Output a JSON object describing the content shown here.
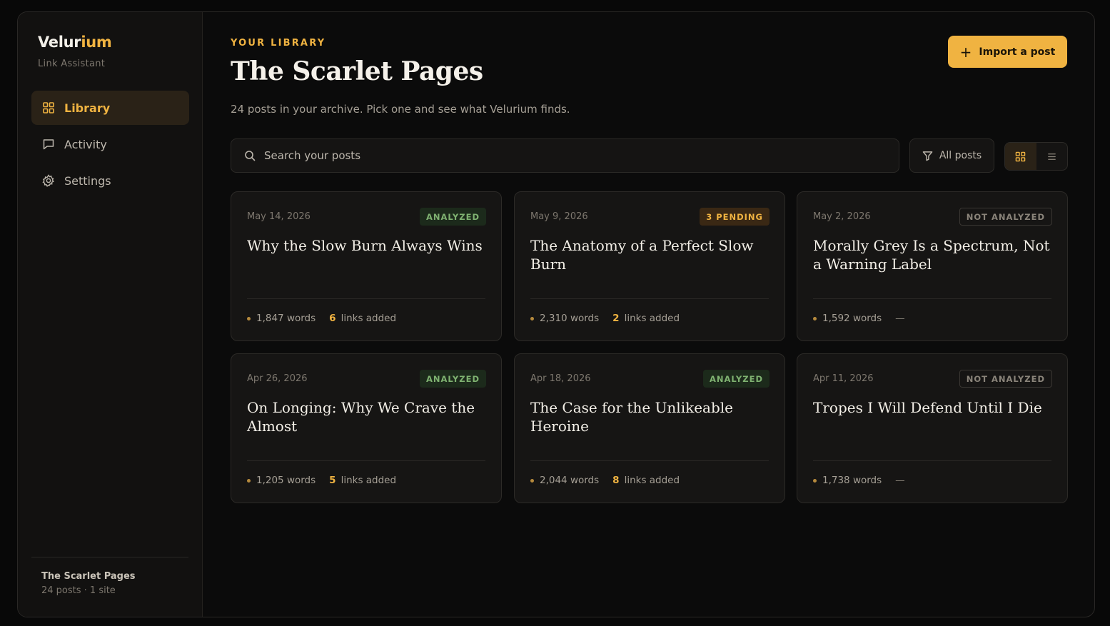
{
  "sidebar": {
    "brand_prefix": "Velur",
    "brand_accent": "ium",
    "brand_sub": "Link Assistant",
    "items": [
      {
        "label": "Library",
        "icon": "grid-icon",
        "active": true
      },
      {
        "label": "Activity",
        "icon": "chat-icon",
        "active": false
      },
      {
        "label": "Settings",
        "icon": "gear-icon",
        "active": false
      }
    ],
    "footer_title": "The Scarlet Pages",
    "footer_sub": "24 posts · 1 site"
  },
  "header": {
    "eyebrow": "YOUR LIBRARY",
    "title": "The Scarlet Pages",
    "subtitle": "24 posts in your archive. Pick one and see what Velurium finds.",
    "import_label": "Import a post"
  },
  "toolbar": {
    "search_placeholder": "Search your posts",
    "search_value": "",
    "filter_label": "All posts",
    "view_mode": "grid"
  },
  "posts": [
    {
      "date": "May 14, 2026",
      "status": "ANALYZED",
      "title": "Why the Slow Burn Always Wins",
      "words": "1,847 words",
      "links_count": "6",
      "links_label": "links added"
    },
    {
      "date": "May 9, 2026",
      "status": "3 PENDING",
      "title": "The Anatomy of a Perfect Slow Burn",
      "words": "2,310 words",
      "links_count": "2",
      "links_label": "links added"
    },
    {
      "date": "May 2, 2026",
      "status": "NOT ANALYZED",
      "title": "Morally Grey Is a Spectrum, Not a Warning Label",
      "words": "1,592 words",
      "links_count": "",
      "links_label": "—"
    },
    {
      "date": "Apr 26, 2026",
      "status": "ANALYZED",
      "title": "On Longing: Why We Crave the Almost",
      "words": "1,205 words",
      "links_count": "5",
      "links_label": "links added"
    },
    {
      "date": "Apr 18, 2026",
      "status": "ANALYZED",
      "title": "The Case for the Unlikeable Heroine",
      "words": "2,044 words",
      "links_count": "8",
      "links_label": "links added"
    },
    {
      "date": "Apr 11, 2026",
      "status": "NOT ANALYZED",
      "title": "Tropes I Will Defend Until I Die",
      "words": "1,738 words",
      "links_count": "",
      "links_label": "—"
    }
  ],
  "colors": {
    "accent": "#f0b341",
    "analyzed": "#7fb271",
    "background": "#0b0b0b"
  }
}
